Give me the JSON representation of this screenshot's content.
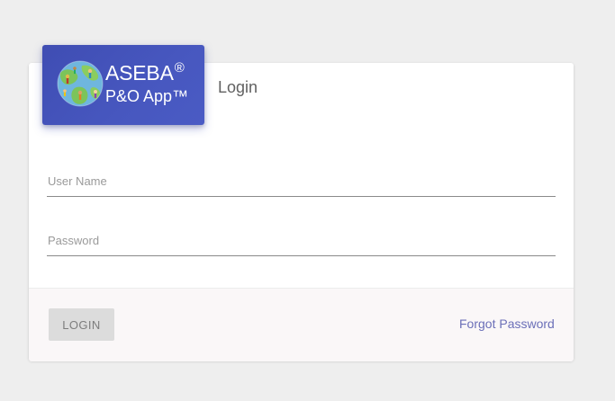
{
  "brand": {
    "name": "ASEBA",
    "registered_mark": "®",
    "subtitle": "P&O App™",
    "logo_icon": "globe-with-people-icon"
  },
  "login": {
    "title": "Login",
    "username_placeholder": "User Name",
    "username_value": "",
    "password_placeholder": "Password",
    "password_value": "",
    "login_button": "LOGIN",
    "forgot_link": "Forgot Password"
  },
  "colors": {
    "background": "#eeeeee",
    "logo_blue": "#4353bb",
    "link": "#6b6fb8",
    "button_disabled": "#dcdcdc"
  }
}
